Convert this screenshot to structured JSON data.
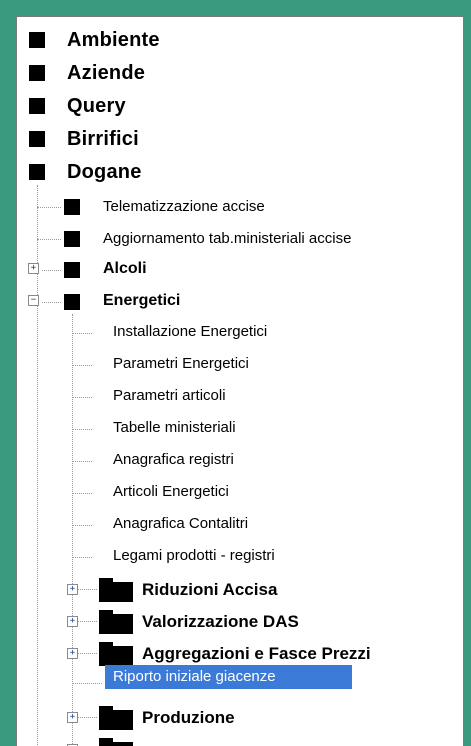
{
  "tree": {
    "top_items": [
      {
        "label": "Ambiente"
      },
      {
        "label": "Aziende"
      },
      {
        "label": "Query"
      },
      {
        "label": "Birrifici"
      },
      {
        "label": "Dogane"
      }
    ],
    "dogane_children": [
      {
        "label": "Telematizzazione accise"
      },
      {
        "label": "Aggiornamento tab.ministeriali accise"
      },
      {
        "label": "Alcoli",
        "expander": "+"
      },
      {
        "label": "Energetici",
        "expander": "−"
      }
    ],
    "energetici_leaves": [
      {
        "label": "Installazione Energetici"
      },
      {
        "label": "Parametri Energetici"
      },
      {
        "label": "Parametri articoli"
      },
      {
        "label": "Tabelle ministeriali"
      },
      {
        "label": "Anagrafica registri"
      },
      {
        "label": "Articoli Energetici"
      },
      {
        "label": "Anagrafica Contalitri"
      },
      {
        "label": "Legami prodotti - registri"
      }
    ],
    "energetici_folders": [
      {
        "label": "Riduzioni Accisa",
        "expander": "+"
      },
      {
        "label": "Valorizzazione DAS",
        "expander": "+"
      },
      {
        "label": "Aggregazioni e Fasce Prezzi",
        "expander": "+"
      }
    ],
    "selected_item": {
      "label": "Riporto iniziale giacenze"
    },
    "bottom_folders": [
      {
        "label": "Produzione",
        "expander": "+"
      }
    ]
  },
  "colors": {
    "frame": "#3a9a80",
    "selection": "#3b7ad6"
  }
}
